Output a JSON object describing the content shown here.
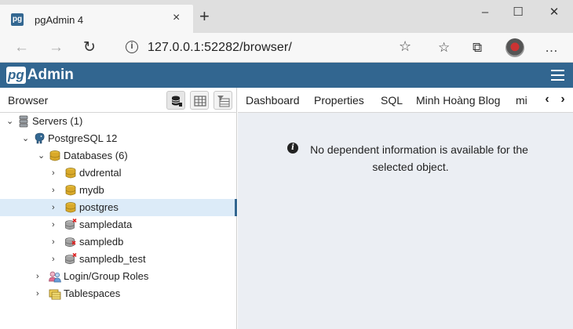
{
  "browser": {
    "tab_title": "pgAdmin 4",
    "tab_favicon": "pg",
    "address": "127.0.0.1:52282/browser/",
    "icons": {
      "close": "×",
      "new_tab": "+",
      "minimize": "–",
      "maximize": "☐",
      "window_close": "✕",
      "back": "←",
      "forward": "→",
      "refresh": "↻",
      "info": "i",
      "star": "☆",
      "favorites": "☆",
      "collections": "⧉",
      "more": "…"
    }
  },
  "app": {
    "logo_pg": "pg",
    "logo_admin": "Admin"
  },
  "left_panel": {
    "title": "Browser",
    "tree": [
      {
        "label": "Servers (1)",
        "expanded": true,
        "level": 0,
        "icon": "servers-icon"
      },
      {
        "label": "PostgreSQL 12",
        "expanded": true,
        "level": 1,
        "icon": "postgres-elephant-icon"
      },
      {
        "label": "Databases (6)",
        "expanded": true,
        "level": 2,
        "icon": "databases-icon"
      },
      {
        "label": "dvdrental",
        "expanded": false,
        "level": 3,
        "icon": "database-icon"
      },
      {
        "label": "mydb",
        "expanded": false,
        "level": 3,
        "icon": "database-icon"
      },
      {
        "label": "postgres",
        "expanded": false,
        "level": 3,
        "icon": "database-icon",
        "selected": true
      },
      {
        "label": "sampledata",
        "expanded": false,
        "level": 3,
        "icon": "database-disconnected-icon"
      },
      {
        "label": "sampledb",
        "expanded": false,
        "level": 3,
        "icon": "database-disconnected-icon"
      },
      {
        "label": "sampledb_test",
        "expanded": false,
        "level": 3,
        "icon": "database-disconnected-icon"
      },
      {
        "label": "Login/Group Roles",
        "expanded": false,
        "level": 2,
        "icon": "roles-icon"
      },
      {
        "label": "Tablespaces",
        "expanded": false,
        "level": 2,
        "icon": "tablespaces-icon"
      }
    ]
  },
  "right_panel": {
    "tabs": [
      "Dashboard",
      "Properties",
      "SQL",
      "Minh Hoàng Blog",
      "mi"
    ],
    "prev_arrow": "‹",
    "next_arrow": "›",
    "message": "No dependent information is available for the selected object."
  },
  "colors": {
    "header": "#326690",
    "selection": "#dcebf8",
    "content_bg": "#ebeef3"
  }
}
